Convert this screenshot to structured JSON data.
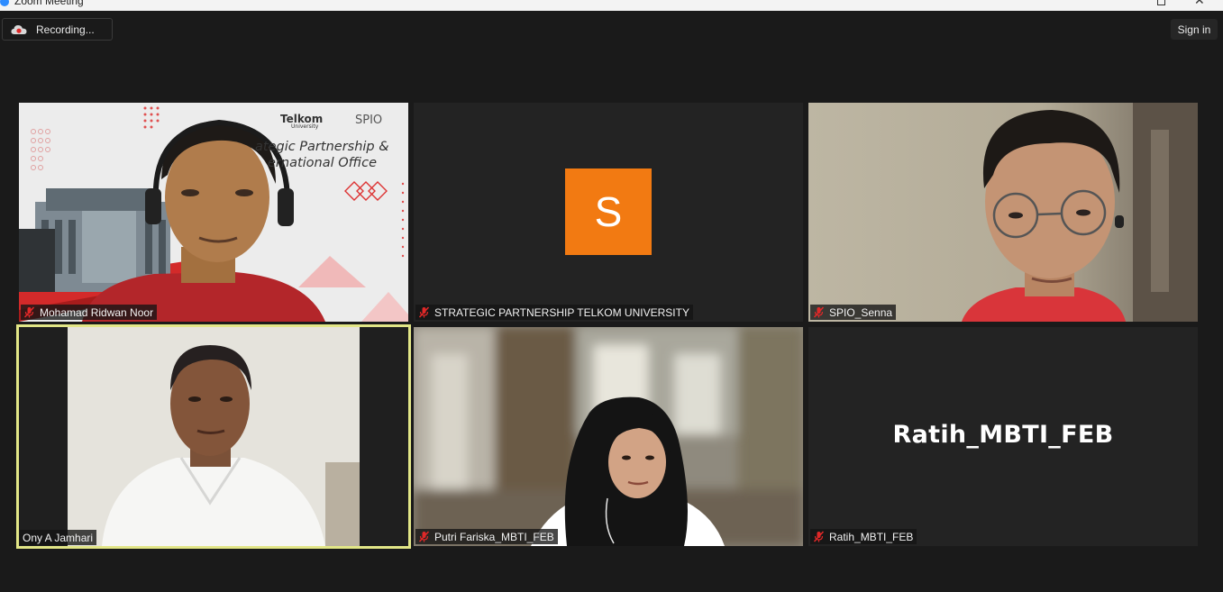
{
  "window": {
    "title": "Zoom Meeting"
  },
  "topbar": {
    "recording_label": "Recording...",
    "sign_in_label": "Sign in"
  },
  "tiles": [
    {
      "name": "Mohamad Ridwan Noor",
      "muted": true,
      "backdrop": {
        "brand": "Telkom",
        "brand_sub": "University",
        "spio": "SPIO",
        "line1": "ategic Partnership &",
        "line2": "ernational Office"
      }
    },
    {
      "name": "STRATEGIC PARTNERSHIP TELKOM UNIVERSITY",
      "muted": true,
      "avatar_letter": "S",
      "avatar_color": "#f27a12"
    },
    {
      "name": "SPIO_Senna",
      "muted": true
    },
    {
      "name": "Ony A Jamhari",
      "muted": false,
      "active_speaker": true,
      "highlight_color": "#e2e687"
    },
    {
      "name": "Putri Fariska_MBTI_FEB",
      "muted": true
    },
    {
      "name": "Ratih_MBTI_FEB",
      "muted": true,
      "display_name": "Ratih_MBTI_FEB"
    }
  ],
  "icons": {
    "muted_mic": "mic-muted-icon",
    "recording": "cloud-record-icon"
  },
  "colors": {
    "background": "#1a1a1a",
    "muted": "#e02828",
    "accent": "#2d8cff"
  }
}
